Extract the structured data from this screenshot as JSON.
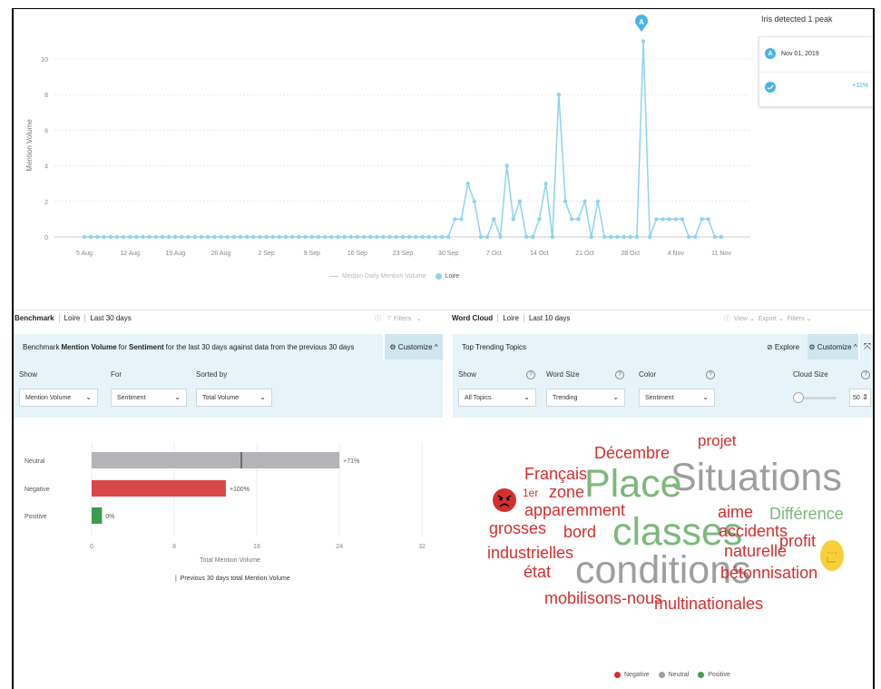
{
  "line_chart": {
    "ylabel": "Mention Volume",
    "y_ticks": [
      "0",
      "2",
      "4",
      "6",
      "8",
      "10"
    ],
    "x_ticks": [
      "5 Aug",
      "12 Aug",
      "19 Aug",
      "26 Aug",
      "2 Sep",
      "9 Sep",
      "16 Sep",
      "23 Sep",
      "30 Sep",
      "7 Oct",
      "14 Oct",
      "21 Oct",
      "28 Oct",
      "4 Nov",
      "11 Nov"
    ],
    "legend_median": "Median Daily Mention Volume",
    "legend_series": "Loire",
    "peak_marker": "A",
    "series_color": "#8ed3ef"
  },
  "chart_data": {
    "type": "line",
    "ylabel": "Mention Volume",
    "ylim": [
      0,
      11
    ],
    "series": [
      {
        "name": "Loire",
        "values": [
          0,
          0,
          0,
          0,
          0,
          0,
          0,
          0,
          0,
          0,
          0,
          0,
          0,
          0,
          0,
          0,
          0,
          0,
          0,
          0,
          0,
          0,
          0,
          0,
          0,
          0,
          0,
          0,
          0,
          0,
          0,
          0,
          0,
          0,
          0,
          0,
          0,
          0,
          0,
          0,
          0,
          0,
          0,
          0,
          0,
          0,
          0,
          0,
          0,
          0,
          0,
          0,
          0,
          0,
          0,
          0,
          0,
          1,
          1,
          3,
          2,
          0,
          0,
          1,
          0,
          4,
          1,
          2,
          0,
          0,
          1,
          3,
          0,
          8,
          2,
          1,
          1,
          2,
          0,
          2,
          0,
          0,
          0,
          0,
          0,
          0,
          11,
          0,
          1,
          1,
          1,
          1,
          1,
          0,
          0,
          1,
          1,
          0,
          0
        ]
      }
    ]
  },
  "peak": {
    "title": "Iris detected 1 peak",
    "label": "A",
    "date": "Nov 01, 2019",
    "change": "+11%"
  },
  "benchmark": {
    "tabs": [
      "Benchmark",
      "Loire",
      "Last 30 days"
    ],
    "filters_label": "Filters",
    "header_prefix": "Benchmark ",
    "header_metric": "Mention Volume",
    "header_mid": " for ",
    "header_dim": "Sentiment",
    "header_suffix": " for the last 30 days against data from the previous 30 days",
    "customize": "Customize",
    "show_label": "Show",
    "for_label": "For",
    "sorted_label": "Sorted by",
    "show_value": "Mention Volume",
    "for_value": "Sentiment",
    "sorted_value": "Total Volume",
    "xlabel": "Total Mention Volume",
    "legend": "Previous 30 days total Mention Volume",
    "x_ticks": [
      "0",
      "8",
      "16",
      "24",
      "32"
    ],
    "rows": [
      {
        "label": "Neutral",
        "value": 24,
        "prev": 14.5,
        "change": "+71%",
        "color": "#b4b4b8"
      },
      {
        "label": "Negative",
        "value": 13,
        "prev": null,
        "change": "+100%",
        "color": "#d94848"
      },
      {
        "label": "Positive",
        "value": 1,
        "prev": null,
        "change": "0%",
        "color": "#3f9a4f"
      }
    ]
  },
  "wordcloud": {
    "tabs": [
      "Word Cloud",
      "Loire",
      "Last 10 days"
    ],
    "view_label": "View",
    "export_label": "Export",
    "filters_label": "Filters",
    "header": "Top Trending Topics",
    "explore": "Explore",
    "customize": "Customize",
    "show_label": "Show",
    "wordsize_label": "Word Size",
    "color_label": "Color",
    "cloudsize_label": "Cloud Size",
    "show_value": "All Topics",
    "wordsize_value": "Trending",
    "color_value": "Sentiment",
    "cloudsize_value": "50",
    "words": {
      "projet": "projet",
      "decembre": "Décembre",
      "situations": "Situations",
      "francais": "Français",
      "place": "Place",
      "zone": "zone",
      "premier": "1er",
      "apparemment": "apparemment",
      "aime": "aime",
      "difference": "Différence",
      "grosses": "grosses",
      "bord": "bord",
      "classes": "classes",
      "accidents": "accidents",
      "profit": "profit",
      "naturelle": "naturelle",
      "industrielles": "industrielles",
      "conditions": "conditions",
      "etat": "état",
      "betonnisation": "bétonnisation",
      "mobilisons": "mobilisons-nous",
      "multinationales": "multinationales"
    },
    "legend": {
      "negative": "Negative",
      "neutral": "Neutral",
      "positive": "Positive"
    },
    "colors": {
      "negative": "#d32f2f",
      "neutral": "#9e9e9e",
      "positive": "#43a047"
    }
  }
}
